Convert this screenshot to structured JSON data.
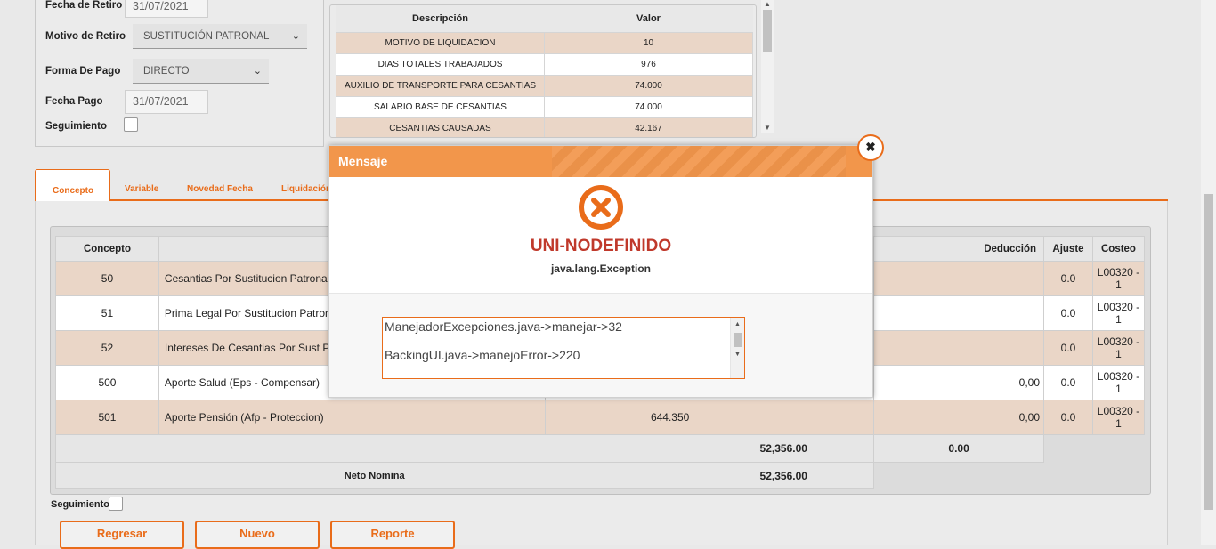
{
  "form": {
    "fecha_retiro_label": "Fecha de Retiro",
    "fecha_retiro_value": "31/07/2021",
    "motivo_label": "Motivo de Retiro",
    "motivo_value": "SUSTITUCIÓN PATRONAL",
    "forma_pago_label": "Forma De Pago",
    "forma_pago_value": "DIRECTO",
    "fecha_pago_label": "Fecha Pago",
    "fecha_pago_value": "31/07/2021",
    "seguimiento_label": "Seguimiento"
  },
  "resumen": {
    "headers": [
      "Descripción",
      "Valor"
    ],
    "rows": [
      {
        "desc": "MOTIVO DE LIQUIDACION",
        "valor": "10"
      },
      {
        "desc": "DIAS TOTALES TRABAJADOS",
        "valor": "976"
      },
      {
        "desc": "AUXILIO DE TRANSPORTE PARA CESANTIAS",
        "valor": "74.000"
      },
      {
        "desc": "SALARIO BASE DE CESANTIAS",
        "valor": "74.000"
      },
      {
        "desc": "CESANTIAS CAUSADAS",
        "valor": "42.167"
      }
    ]
  },
  "tabs": [
    "Concepto",
    "Variable",
    "Novedad Fecha",
    "Liquidación"
  ],
  "conceptos": {
    "headers": [
      "Concepto",
      "",
      "",
      "",
      "Deducción",
      "Ajuste",
      "Costeo"
    ],
    "rows": [
      {
        "code": "50",
        "name": "Cesantias Por Sustitucion Patrona",
        "valor": "",
        "deduccion": "",
        "ajuste": "0.0",
        "costeo": "L00320 - 1"
      },
      {
        "code": "51",
        "name": "Prima Legal Por Sustitucion Patron",
        "valor": "",
        "deduccion": "",
        "ajuste": "0.0",
        "costeo": "L00320 - 1"
      },
      {
        "code": "52",
        "name": "Intereses De Cesantias Por Sust P",
        "valor": "",
        "deduccion": "",
        "ajuste": "0.0",
        "costeo": "L00320 - 1"
      },
      {
        "code": "500",
        "name": "Aporte Salud (Eps - Compensar)",
        "valor": "",
        "deduccion": "0,00",
        "ajuste": "0.0",
        "costeo": "L00320 - 1"
      },
      {
        "code": "501",
        "name": "Aporte Pensión (Afp - Proteccion)",
        "valor": "644.350",
        "deduccion": "0,00",
        "ajuste": "0.0",
        "costeo": "L00320 - 1"
      }
    ],
    "total_devengado": "52,356.00",
    "total_deduccion": "0.00",
    "neto_label": "Neto Nomina",
    "neto_value": "52,356.00"
  },
  "seguimiento2_label": "Seguimiento",
  "buttons": {
    "regresar": "Regresar",
    "nuevo": "Nuevo",
    "reporte": "Reporte"
  },
  "modal": {
    "title": "Mensaje",
    "error_title": "UNI-NODEFINIDO",
    "error_sub": "java.lang.Exception",
    "trace_line1": "ManejadorExcepciones.java->manejar->32",
    "trace_line2": "BackingUI.java->manejoError->220",
    "close_icon": "close-icon"
  },
  "colors": {
    "accent": "#e96c1a",
    "header": "#f2964b",
    "error_red": "#c0392b",
    "peach": "#ead6c7"
  }
}
